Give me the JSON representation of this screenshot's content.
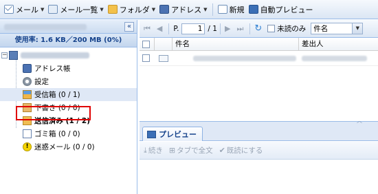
{
  "toolbar": {
    "mail": "メール",
    "mail_list": "メール一覧",
    "folder": "フォルダ",
    "address": "アドレス",
    "new": "新規",
    "auto_preview": "自動プレビュー",
    "icons": [
      "mail-icon",
      "mail-list-icon",
      "folder-icon",
      "address-book-icon",
      "new-mail-icon",
      "monitor-icon"
    ]
  },
  "left_panel": {
    "collapse": "«",
    "usage": "使用率: 1.6 KB／200 MB (0%)",
    "folders": [
      {
        "label": "アドレス帳",
        "icon": "address-book-icon"
      },
      {
        "label": "設定",
        "icon": "gear-icon"
      },
      {
        "label": "受信箱 (0 / 1)",
        "icon": "inbox-icon",
        "selected": true
      },
      {
        "label": "下書き (0 / 0)",
        "icon": "draft-icon"
      },
      {
        "label": "送信済み (1 / 2)",
        "icon": "sent-icon",
        "bold": true
      },
      {
        "label": "ゴミ箱 (0 / 0)",
        "icon": "trash-icon"
      },
      {
        "label": "迷惑メール (0 / 0)",
        "icon": "spam-icon"
      }
    ]
  },
  "pager": {
    "first": "⏮",
    "prev": "◀",
    "page_label": "P.",
    "page_value": "1",
    "page_total": "/ 1",
    "next": "▶",
    "last": "⏭",
    "unread_only": "未読のみ",
    "sort_value": "件名"
  },
  "grid": {
    "subject_header": "件名",
    "from_header": "差出人"
  },
  "preview": {
    "tab": "プレビュー",
    "continue": "続き",
    "open_in_tab": "タブで全文",
    "mark_read": "既読にする"
  },
  "colors": {
    "accent": "#15428b",
    "border": "#99bbe8",
    "selection": "#dfe8f6",
    "highlight": "#e00000"
  }
}
